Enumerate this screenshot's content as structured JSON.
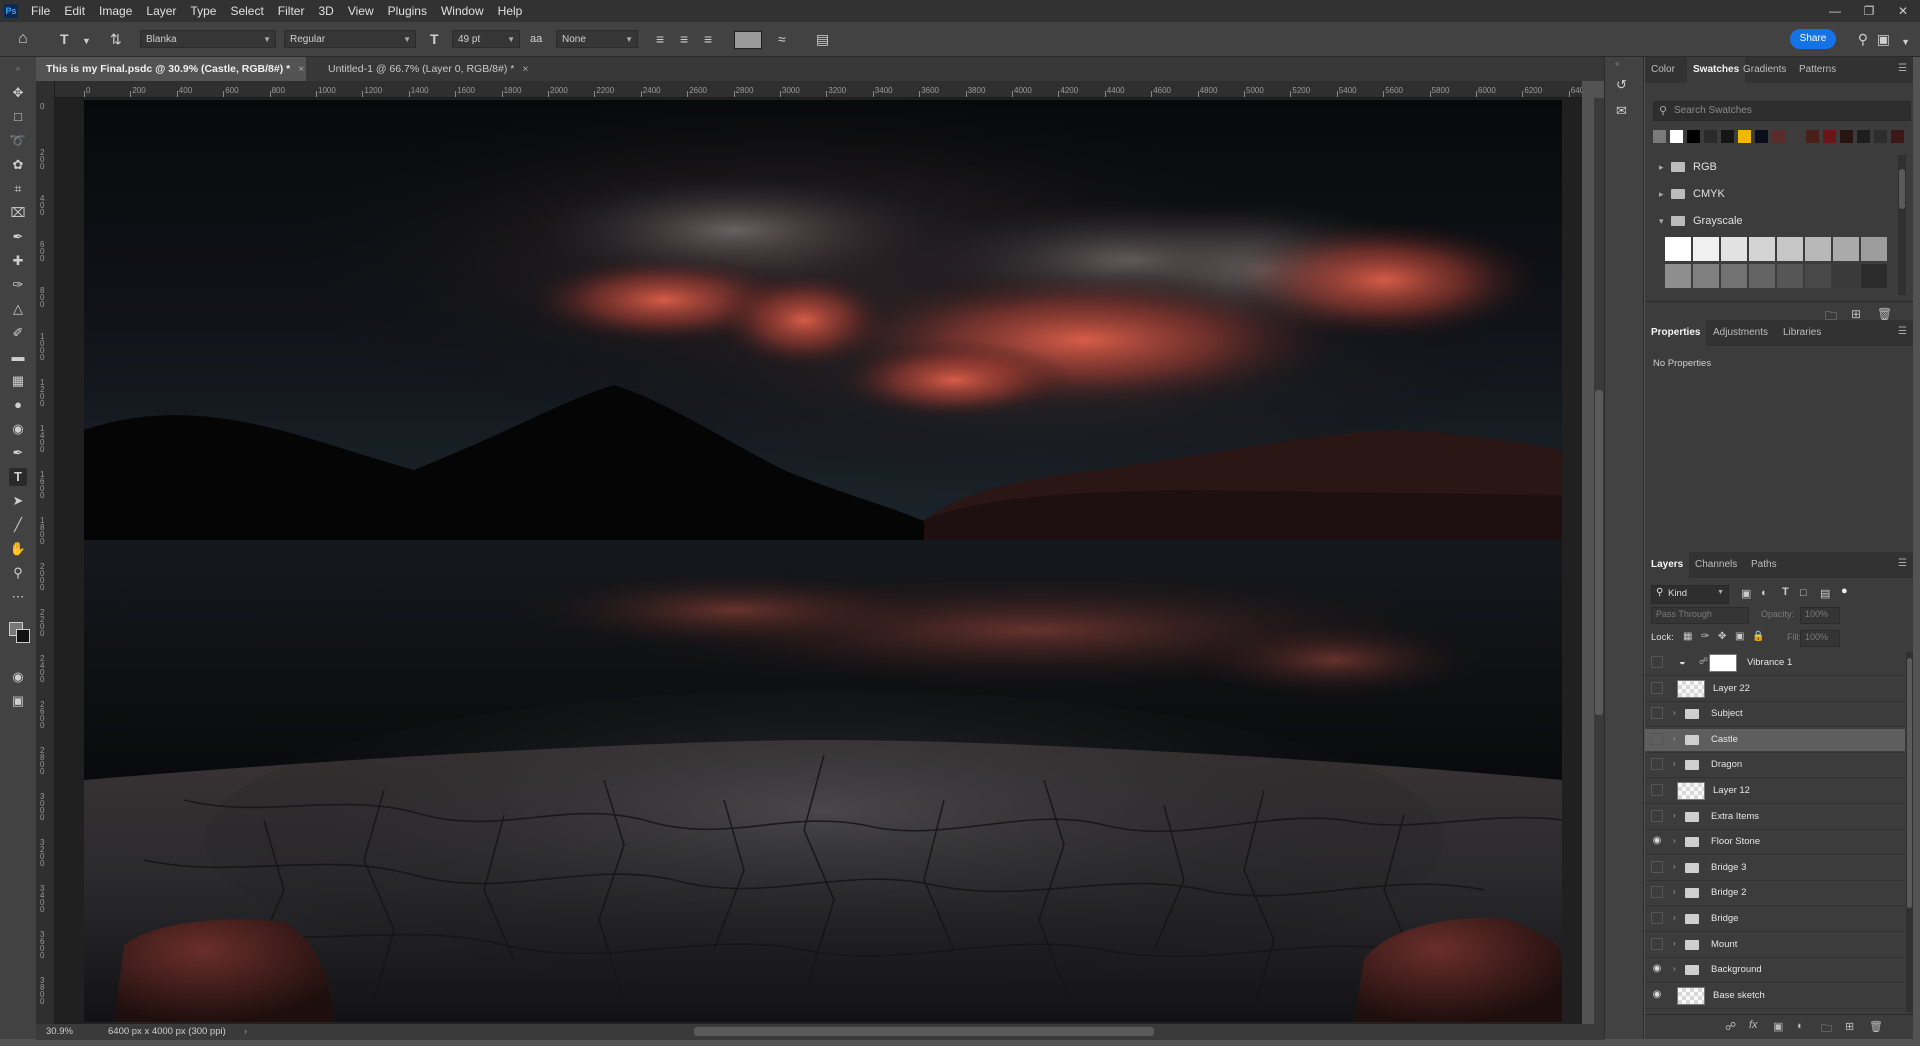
{
  "app": {
    "logo": "Ps",
    "menus": [
      "File",
      "Edit",
      "Image",
      "Layer",
      "Type",
      "Select",
      "Filter",
      "3D",
      "View",
      "Plugins",
      "Window",
      "Help"
    ],
    "window_controls": [
      "minimize-icon",
      "restore-icon",
      "close-icon"
    ]
  },
  "options_bar": {
    "font_family": "Blanka",
    "font_style": "Regular",
    "font_size": "49 pt",
    "anti_alias": "None",
    "share_label": "Share"
  },
  "tabs": [
    {
      "label": "This is my Final.psdc @ 30.9% (Castle, RGB/8#) *",
      "active": true
    },
    {
      "label": "Untitled-1 @ 66.7% (Layer 0, RGB/8#) *",
      "active": false
    }
  ],
  "ruler": {
    "top_ticks": [
      "0",
      "200",
      "400",
      "600",
      "800",
      "1000",
      "1200",
      "1400",
      "1600",
      "1800",
      "2000",
      "2200",
      "2400",
      "2600",
      "2800",
      "3000",
      "3200",
      "3400",
      "3600",
      "3800",
      "4000",
      "4200",
      "4400",
      "4600",
      "4800",
      "5000",
      "5200",
      "5400",
      "5600",
      "5800",
      "6000",
      "6200",
      "6400"
    ],
    "left_ticks": [
      "0",
      "200",
      "400",
      "600",
      "800",
      "1000",
      "1200",
      "1400",
      "1600",
      "1800",
      "2000",
      "2200",
      "2400",
      "2600",
      "2800",
      "3000",
      "3200",
      "3400",
      "3600",
      "3800"
    ]
  },
  "status": {
    "zoom": "30.9%",
    "doc_info": "6400 px x 4000 px (300 ppi)"
  },
  "swatches_panel": {
    "tabs": [
      "Color",
      "Swatches",
      "Gradients",
      "Patterns"
    ],
    "active_tab": "Swatches",
    "search_placeholder": "Search Swatches",
    "recent_colors": [
      "#7a7a7a",
      "#ffffff",
      "#000000",
      "#2b2b2b",
      "#151515",
      "#f5b800",
      "#0b0d1a",
      "#5a2b2b",
      "#3c3c3c",
      "#4a1f1a",
      "#6b1616",
      "#2a1412",
      "#1e1e1e",
      "#2d2d2d",
      "#3d1816"
    ],
    "folders": [
      {
        "name": "RGB",
        "expanded": false
      },
      {
        "name": "CMYK",
        "expanded": false
      },
      {
        "name": "Grayscale",
        "expanded": true
      }
    ],
    "grayscale_colors": [
      "#ffffff",
      "#f0f0f0",
      "#e2e2e2",
      "#d4d4d4",
      "#c6c6c6",
      "#b8b8b8",
      "#aaaaaa",
      "#9c9c9c",
      "#8e8e8e",
      "#808080",
      "#727272",
      "#646464",
      "#565656",
      "#484848",
      "#3a3a3a",
      "#2c2c2c"
    ]
  },
  "properties_panel": {
    "tabs": [
      "Properties",
      "Adjustments",
      "Libraries"
    ],
    "active_tab": "Properties",
    "content": "No Properties"
  },
  "layers_panel": {
    "tabs": [
      "Layers",
      "Channels",
      "Paths"
    ],
    "active_tab": "Layers",
    "filter_label": "Kind",
    "blend_mode": "Pass Through",
    "opacity_label": "Opacity:",
    "opacity_value": "100%",
    "lock_label": "Lock:",
    "fill_label": "Fill:",
    "fill_value": "100%",
    "layers": [
      {
        "name": "Vibrance 1",
        "type": "adjustment",
        "visible": false,
        "selected": false
      },
      {
        "name": "Layer 22",
        "type": "pixel",
        "visible": false,
        "selected": false
      },
      {
        "name": "Subject",
        "type": "group",
        "visible": false,
        "selected": false
      },
      {
        "name": "Castle",
        "type": "group",
        "visible": false,
        "selected": true
      },
      {
        "name": "Dragon",
        "type": "group",
        "visible": false,
        "selected": false
      },
      {
        "name": "Layer 12",
        "type": "pixel",
        "visible": false,
        "selected": false
      },
      {
        "name": "Extra Items",
        "type": "group",
        "visible": false,
        "selected": false
      },
      {
        "name": "Floor Stone",
        "type": "group",
        "visible": true,
        "selected": false
      },
      {
        "name": "Bridge 3",
        "type": "group",
        "visible": false,
        "selected": false
      },
      {
        "name": "Bridge 2",
        "type": "group",
        "visible": false,
        "selected": false
      },
      {
        "name": "Bridge",
        "type": "group",
        "visible": false,
        "selected": false
      },
      {
        "name": "Mount",
        "type": "group",
        "visible": false,
        "selected": false
      },
      {
        "name": "Background",
        "type": "group",
        "visible": true,
        "selected": false
      },
      {
        "name": "Base sketch",
        "type": "pixel",
        "visible": true,
        "selected": false
      }
    ]
  }
}
